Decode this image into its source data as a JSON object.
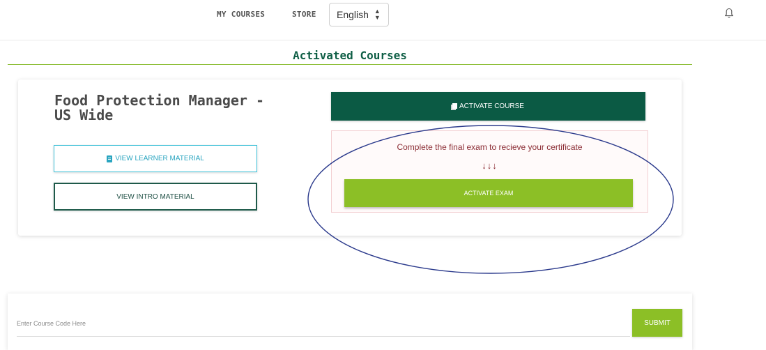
{
  "nav": {
    "my_courses": "MY COURSES",
    "store": "STORE",
    "language": {
      "selected": "English",
      "caret": "⬍"
    },
    "notification_icon": "bell-icon"
  },
  "section": {
    "title": "Activated Courses"
  },
  "course": {
    "title": "Food Protection Manager - US Wide",
    "learner_button": {
      "label": "VIEW LEARNER MATERIAL",
      "icon": "book-icon"
    },
    "intro_button": {
      "label": "VIEW INTRO MATERIAL"
    },
    "activate_course_button": {
      "label": "ACTIVATE COURSE",
      "icon": "copy-icon"
    },
    "exam": {
      "message": "Complete the final exam to recieve your certificate",
      "arrows": "↓↓↓",
      "button_label": "ACTIVATE EXAM"
    }
  },
  "code_form": {
    "placeholder": "Enter Course Code Here",
    "submit_label": "SUBMIT"
  },
  "colors": {
    "brand_dark_green": "#0b5a44",
    "accent_green": "#8cbf26",
    "title_green": "#0e5e45",
    "learner_cyan": "#3cc0d8",
    "exam_text": "#8b2c34",
    "annotation_ellipse": "#2b3a8c"
  }
}
